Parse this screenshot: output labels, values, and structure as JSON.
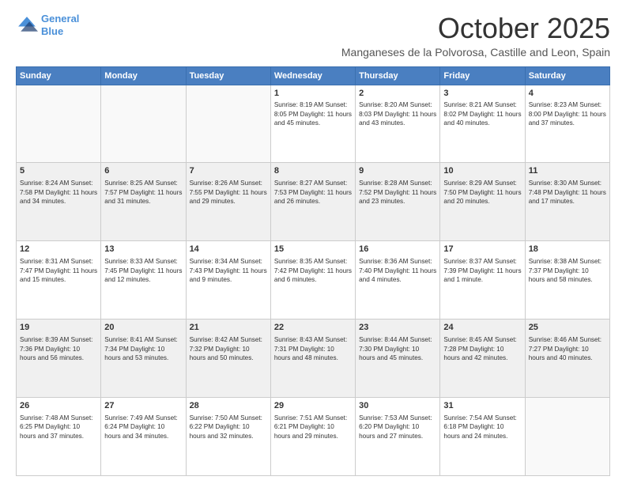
{
  "logo": {
    "line1": "General",
    "line2": "Blue"
  },
  "title": "October 2025",
  "location": "Manganeses de la Polvorosa, Castille and Leon, Spain",
  "weekdays": [
    "Sunday",
    "Monday",
    "Tuesday",
    "Wednesday",
    "Thursday",
    "Friday",
    "Saturday"
  ],
  "weeks": [
    [
      {
        "day": "",
        "info": ""
      },
      {
        "day": "",
        "info": ""
      },
      {
        "day": "",
        "info": ""
      },
      {
        "day": "1",
        "info": "Sunrise: 8:19 AM\nSunset: 8:05 PM\nDaylight: 11 hours\nand 45 minutes."
      },
      {
        "day": "2",
        "info": "Sunrise: 8:20 AM\nSunset: 8:03 PM\nDaylight: 11 hours\nand 43 minutes."
      },
      {
        "day": "3",
        "info": "Sunrise: 8:21 AM\nSunset: 8:02 PM\nDaylight: 11 hours\nand 40 minutes."
      },
      {
        "day": "4",
        "info": "Sunrise: 8:23 AM\nSunset: 8:00 PM\nDaylight: 11 hours\nand 37 minutes."
      }
    ],
    [
      {
        "day": "5",
        "info": "Sunrise: 8:24 AM\nSunset: 7:58 PM\nDaylight: 11 hours\nand 34 minutes."
      },
      {
        "day": "6",
        "info": "Sunrise: 8:25 AM\nSunset: 7:57 PM\nDaylight: 11 hours\nand 31 minutes."
      },
      {
        "day": "7",
        "info": "Sunrise: 8:26 AM\nSunset: 7:55 PM\nDaylight: 11 hours\nand 29 minutes."
      },
      {
        "day": "8",
        "info": "Sunrise: 8:27 AM\nSunset: 7:53 PM\nDaylight: 11 hours\nand 26 minutes."
      },
      {
        "day": "9",
        "info": "Sunrise: 8:28 AM\nSunset: 7:52 PM\nDaylight: 11 hours\nand 23 minutes."
      },
      {
        "day": "10",
        "info": "Sunrise: 8:29 AM\nSunset: 7:50 PM\nDaylight: 11 hours\nand 20 minutes."
      },
      {
        "day": "11",
        "info": "Sunrise: 8:30 AM\nSunset: 7:48 PM\nDaylight: 11 hours\nand 17 minutes."
      }
    ],
    [
      {
        "day": "12",
        "info": "Sunrise: 8:31 AM\nSunset: 7:47 PM\nDaylight: 11 hours\nand 15 minutes."
      },
      {
        "day": "13",
        "info": "Sunrise: 8:33 AM\nSunset: 7:45 PM\nDaylight: 11 hours\nand 12 minutes."
      },
      {
        "day": "14",
        "info": "Sunrise: 8:34 AM\nSunset: 7:43 PM\nDaylight: 11 hours\nand 9 minutes."
      },
      {
        "day": "15",
        "info": "Sunrise: 8:35 AM\nSunset: 7:42 PM\nDaylight: 11 hours\nand 6 minutes."
      },
      {
        "day": "16",
        "info": "Sunrise: 8:36 AM\nSunset: 7:40 PM\nDaylight: 11 hours\nand 4 minutes."
      },
      {
        "day": "17",
        "info": "Sunrise: 8:37 AM\nSunset: 7:39 PM\nDaylight: 11 hours\nand 1 minute."
      },
      {
        "day": "18",
        "info": "Sunrise: 8:38 AM\nSunset: 7:37 PM\nDaylight: 10 hours\nand 58 minutes."
      }
    ],
    [
      {
        "day": "19",
        "info": "Sunrise: 8:39 AM\nSunset: 7:36 PM\nDaylight: 10 hours\nand 56 minutes."
      },
      {
        "day": "20",
        "info": "Sunrise: 8:41 AM\nSunset: 7:34 PM\nDaylight: 10 hours\nand 53 minutes."
      },
      {
        "day": "21",
        "info": "Sunrise: 8:42 AM\nSunset: 7:32 PM\nDaylight: 10 hours\nand 50 minutes."
      },
      {
        "day": "22",
        "info": "Sunrise: 8:43 AM\nSunset: 7:31 PM\nDaylight: 10 hours\nand 48 minutes."
      },
      {
        "day": "23",
        "info": "Sunrise: 8:44 AM\nSunset: 7:30 PM\nDaylight: 10 hours\nand 45 minutes."
      },
      {
        "day": "24",
        "info": "Sunrise: 8:45 AM\nSunset: 7:28 PM\nDaylight: 10 hours\nand 42 minutes."
      },
      {
        "day": "25",
        "info": "Sunrise: 8:46 AM\nSunset: 7:27 PM\nDaylight: 10 hours\nand 40 minutes."
      }
    ],
    [
      {
        "day": "26",
        "info": "Sunrise: 7:48 AM\nSunset: 6:25 PM\nDaylight: 10 hours\nand 37 minutes."
      },
      {
        "day": "27",
        "info": "Sunrise: 7:49 AM\nSunset: 6:24 PM\nDaylight: 10 hours\nand 34 minutes."
      },
      {
        "day": "28",
        "info": "Sunrise: 7:50 AM\nSunset: 6:22 PM\nDaylight: 10 hours\nand 32 minutes."
      },
      {
        "day": "29",
        "info": "Sunrise: 7:51 AM\nSunset: 6:21 PM\nDaylight: 10 hours\nand 29 minutes."
      },
      {
        "day": "30",
        "info": "Sunrise: 7:53 AM\nSunset: 6:20 PM\nDaylight: 10 hours\nand 27 minutes."
      },
      {
        "day": "31",
        "info": "Sunrise: 7:54 AM\nSunset: 6:18 PM\nDaylight: 10 hours\nand 24 minutes."
      },
      {
        "day": "",
        "info": ""
      }
    ]
  ]
}
